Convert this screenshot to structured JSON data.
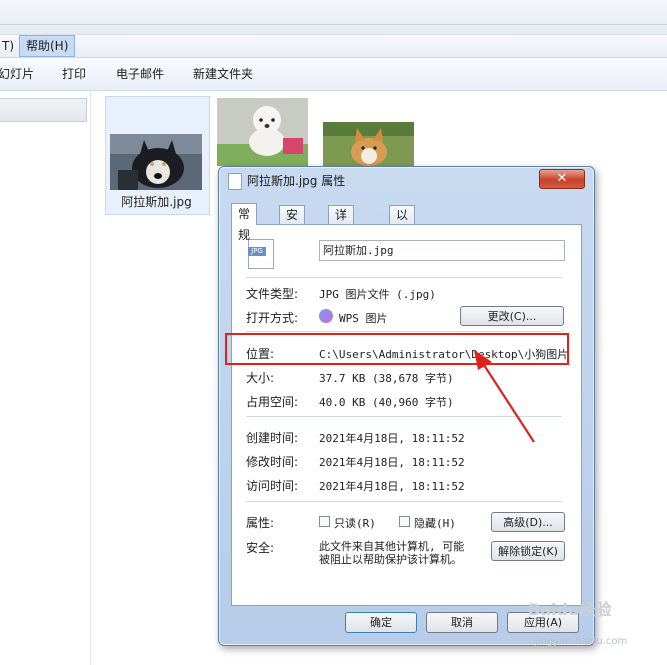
{
  "explorer": {
    "menu": {
      "partial_item": "T)",
      "help": "帮助(H)"
    },
    "toolbar": {
      "slideshow": "幻灯片",
      "print": "打印",
      "email": "电子邮件",
      "new_folder": "新建文件夹"
    },
    "thumbnail_label": "阿拉斯加.jpg"
  },
  "dialog": {
    "title": "阿拉斯加.jpg 属性",
    "close_glyph": "✕",
    "tabs": [
      "常规",
      "安全",
      "详细信息",
      "以前的版本"
    ],
    "filename": "阿拉斯加.jpg",
    "file_icon_text": "JPG",
    "type_label": "文件类型:",
    "type_value": "JPG 图片文件 (.jpg)",
    "opens_label": "打开方式:",
    "opens_value": "WPS 图片",
    "change_button": "更改(C)...",
    "location_label": "位置:",
    "location_value": "C:\\Users\\Administrator\\Desktop\\小狗图片",
    "size_label": "大小:",
    "size_value": "37.7 KB (38,678 字节)",
    "disk_label": "占用空间:",
    "disk_value": "40.0 KB (40,960 字节)",
    "created_label": "创建时间:",
    "created_value": "2021年4月18日, 18:11:52",
    "modified_label": "修改时间:",
    "modified_value": "2021年4月18日, 18:11:52",
    "accessed_label": "访问时间:",
    "accessed_value": "2021年4月18日, 18:11:52",
    "attr_label": "属性:",
    "readonly_label": "只读(R)",
    "hidden_label": "隐藏(H)",
    "advanced_button": "高级(D)...",
    "security_label": "安全:",
    "security_line1": "此文件来自其他计算机, 可能",
    "security_line2": "被阻止以帮助保护该计算机。",
    "unblock_button": "解除锁定(K)",
    "ok_button": "确定",
    "cancel_button": "取消",
    "apply_button": "应用(A)"
  },
  "watermark": {
    "line1": "Baidu经验",
    "line2": "jingyan.baidu.com"
  },
  "colors": {
    "annotation_red": "#e0221a",
    "dialog_frame": "#b6cce8",
    "selected_tile": "#e8f1fb"
  }
}
